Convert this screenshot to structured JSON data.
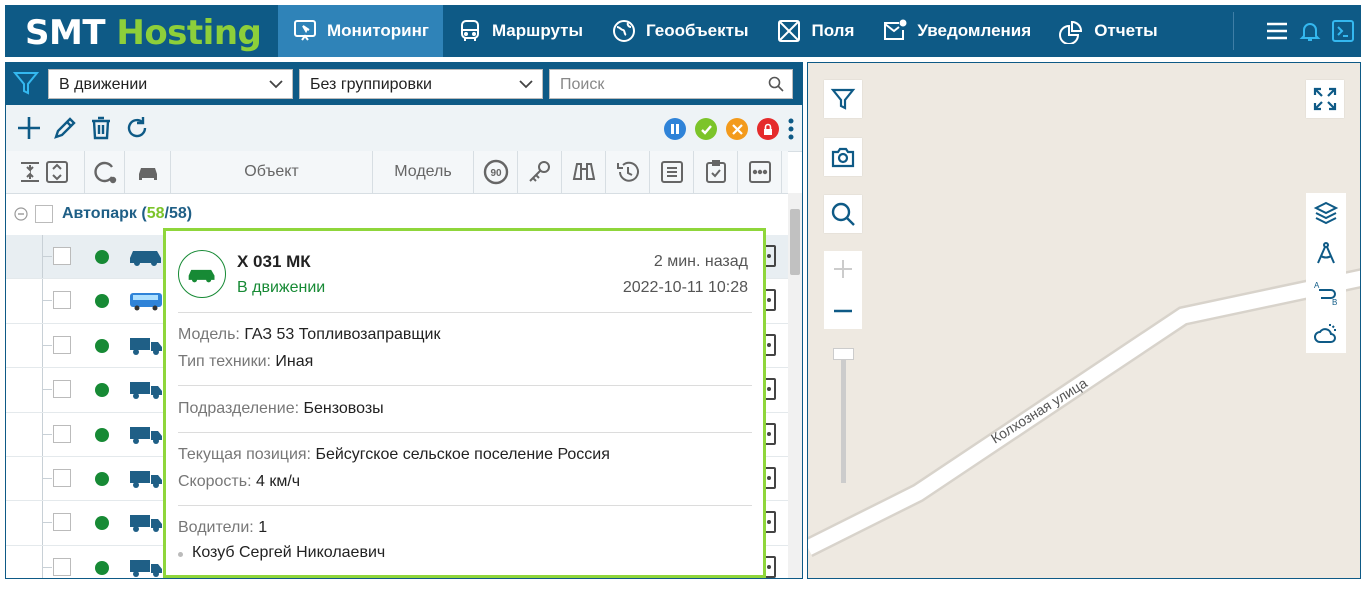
{
  "header": {
    "logo_part1": "SMT",
    "logo_part2": "Hosting",
    "nav": [
      {
        "label": "Мониторинг",
        "icon": "monitor-icon",
        "active": true
      },
      {
        "label": "Маршруты",
        "icon": "bus-icon",
        "active": false
      },
      {
        "label": "Геообъекты",
        "icon": "globe-icon",
        "active": false
      },
      {
        "label": "Поля",
        "icon": "field-icon",
        "active": false
      },
      {
        "label": "Уведомления",
        "icon": "mail-icon",
        "active": false
      },
      {
        "label": "Отчеты",
        "icon": "report-icon",
        "active": false
      }
    ],
    "right_icons": [
      "menu-icon",
      "bell-icon",
      "terminal-icon"
    ]
  },
  "filter": {
    "status_select": "В движении",
    "group_select": "Без группировки",
    "search_placeholder": "Поиск"
  },
  "columns": {
    "object": "Объект",
    "model": "Модель"
  },
  "group": {
    "name": "Автопарк",
    "count_moving": "58",
    "count_total": "58"
  },
  "rows": [
    {
      "vehicle": "car"
    },
    {
      "vehicle": "bus"
    },
    {
      "vehicle": "truck"
    },
    {
      "vehicle": "truck"
    },
    {
      "vehicle": "truck"
    },
    {
      "vehicle": "truck"
    },
    {
      "vehicle": "truck"
    },
    {
      "vehicle": "truck"
    }
  ],
  "popup": {
    "title": "Х 031 МК",
    "status": "В движении",
    "ago": "2 мин. назад",
    "datetime": "2022-10-11 10:28",
    "model_label": "Модель:",
    "model_value": "ГАЗ 53 Топливозаправщик",
    "type_label": "Тип техники:",
    "type_value": "Иная",
    "division_label": "Подразделение:",
    "division_value": "Бензовозы",
    "position_label": "Текущая позиция:",
    "position_value": "Бейсугское сельское поселение Россия",
    "speed_label": "Скорость:",
    "speed_value": "4 км/ч",
    "drivers_label": "Водители:",
    "drivers_count": "1",
    "driver_name": "Козуб Сергей Николаевич"
  },
  "map": {
    "street_name": "Колхозная улица"
  },
  "colors": {
    "header_bg": "#0e5a86",
    "nav_active": "#2f83b8",
    "logo_green": "#8dcf3a",
    "status_green": "#178a35",
    "popup_border": "#8fd63b"
  }
}
